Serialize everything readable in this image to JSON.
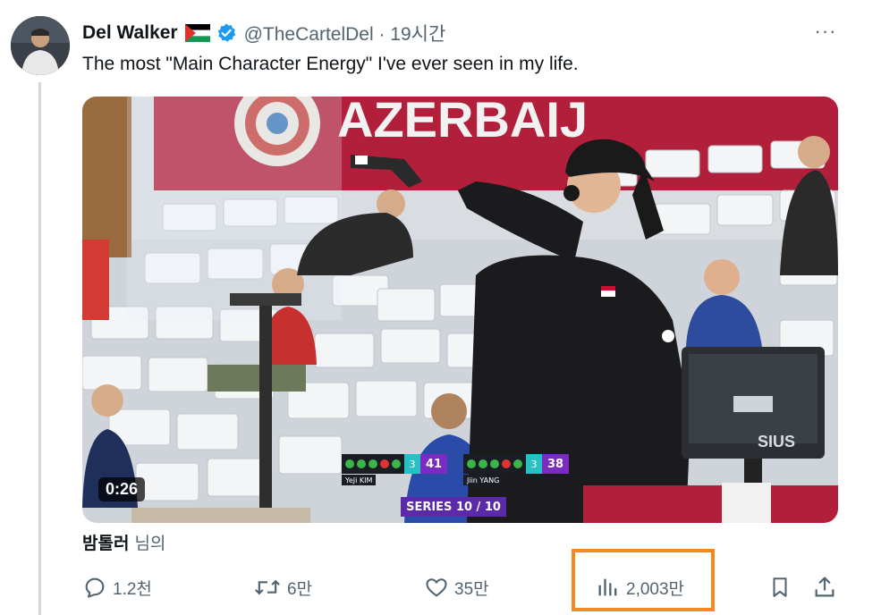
{
  "tweet": {
    "author_name": "Del Walker",
    "handle_time": "@TheCartelDel · 19시간",
    "text": "The most \"Main Character Energy\" I've ever seen in my life.",
    "more_label": "···"
  },
  "media": {
    "duration": "0:26",
    "banner_text": "AZERBAIJ",
    "monitor_brand": "SIUS",
    "scoreboard": {
      "left": {
        "rank": "3",
        "score": "41",
        "name": "YeJi KIM"
      },
      "right": {
        "rank": "3",
        "score": "38",
        "name": "Jiin YANG"
      },
      "series": "SERIES 10 / 10"
    }
  },
  "translate": {
    "author": "밤톨러",
    "suffix": "님의"
  },
  "actions": {
    "reply_count": "1.2천",
    "retweet_count": "6만",
    "like_count": "35만",
    "views_count": "2,003만"
  },
  "colors": {
    "verified": "#1d9bf0",
    "highlight": "#f28a1e",
    "secondary_text": "#536471"
  },
  "icons": [
    "more-icon",
    "verified-icon",
    "flag-icon",
    "reply-icon",
    "retweet-icon",
    "like-icon",
    "views-icon",
    "bookmark-icon",
    "share-icon"
  ]
}
